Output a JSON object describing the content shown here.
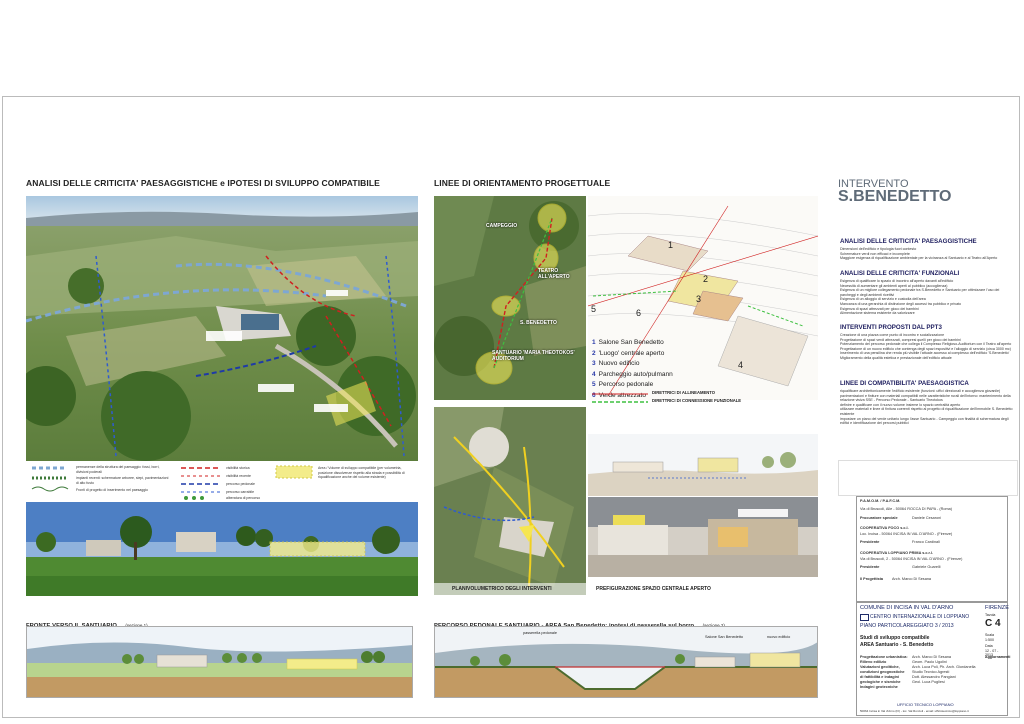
{
  "left_section": {
    "title": "ANALISI DELLE CRITICITA' PAESAGGISTICHE e IPOTESI DI SVILUPPO COMPATIBILE",
    "legend": [
      "permanenze della struttura del paesaggio: fossi, borri, divisioni poderali",
      "impianti recenti: schermature arboree, siepi, pavimentazioni di alto fusto",
      "Fronti di progetto di inserimento nel paesaggio",
      "visibilità storica",
      "visibilità recente",
      "percorso pedonale",
      "percorso carrabile",
      "alberatura di percorso",
      "Area / Volume di sviluppo compatibile (per volumetria, posizione dissolvenze rispetto alla strada e possibilità di riqualificazione anche del volume esistente)"
    ],
    "bottom_caption": "FRONTE VERSO IL SANTUARIO",
    "bottom_caption_note": "(sezione 1)"
  },
  "middle_section": {
    "title": "LINEE DI ORIENTAMENTO PROGETTUALE",
    "map_labels": {
      "campeggio": "CAMPEGGIO",
      "teatro": "TEATRO ALL'APERTO",
      "benedetto": "S. BENEDETTO",
      "santuario": "SANTUARIO 'MARIA THEOTOKOS' AUDITORIUM"
    },
    "numbered_list": [
      {
        "n": "1",
        "label": "Salone San Benedetto"
      },
      {
        "n": "2",
        "label": "'Luogo' centrale aperto"
      },
      {
        "n": "3",
        "label": "Nuovo edificio"
      },
      {
        "n": "4",
        "label": "Parcheggio auto/pulmann"
      },
      {
        "n": "5",
        "label": "Percorso pedonale"
      },
      {
        "n": "6",
        "label": "Verde attrezzato"
      }
    ],
    "direttrici": [
      "DIRETTRICI DI ALLINEAMENTO",
      "DIRETTRICI DI CONNESSIONE FUNZIONALE"
    ],
    "caption_plan": "PLANIVOLUMETRICO DEGLI INTERVENTI",
    "caption_pref": "PREFIGURAZIONE SPAZIO CENTRALE APERTO",
    "bottom_caption": "PERCORSO PEDONALE SANTUARIO - AREA San Benedetto: ipotesi di passerella sul borro",
    "bottom_caption_note": "(sezione 2)",
    "section2_labels": [
      "passerella pedonale",
      "Salone San Benedetto",
      "nuovo edificio"
    ]
  },
  "right_section": {
    "intervento": "INTERVENTO",
    "name": "S.BENEDETTO",
    "blocks": [
      {
        "title": "ANALISI DELLE CRITICITA' PAESAGGISTICHE",
        "items": [
          "Dimensioni dell'edificio e tipologia fuori contesto",
          "Schermature verdi non efficaci e incomplete",
          "Maggiore esigenza di riqualificazione ambientale per la vicinanza al Santuario e al Teatro all'Aperto"
        ]
      },
      {
        "title": "ANALISI DELLE CRITICITA' FUNZIONALI",
        "items": [
          "Esigenza di qualificare lo spazio di incontro all'aperto davanti all'edificio",
          "Necessità di aumentare gli ambienti aperti al pubblico (accoglienza)",
          "Esigenza di un migliore collegamento pedonale tra S.Benedetto e Santuario per ottimizzare l'uso dei parcheggi e degli ambienti ricettivi",
          "Esigenza di un alloggio di servizio e custodia dell'area",
          "Mancanza di una gerarchia di distinzione degli accessi tra pubblico e privato",
          "Esigenza di spazi attrezzati per gioco dei bambini",
          "Alimentazione sistema esistente da valorizzare"
        ]
      },
      {
        "title": "INTERVENTI PROPOSTI DAL PPT3",
        "items": [
          "Creazione di una piazza come punto di incontro e socializzazione",
          "Progettazione di spazi verdi attrezzati, compresi quelli per gioco dei bambini",
          "Potenziamento del percorso pedonale che collega il Complesso Religioso-Auditorium con il Teatro all'aperto",
          "Progettazione di un nuovo edificio che contenga degli spazi espositivi e l'alloggio di servizio (circa 3000 mc)",
          "Inserimento di una pensilina che renda più visibile l'attuale accesso al complesso dell'edificio 'S.Benedetto'",
          "Miglioramento della qualità estetica e prestazionale dell'edificio attuale"
        ]
      },
      {
        "title": "LINEE DI COMPATIBILITA' PAESAGGISTICA",
        "items": [
          "riqualificare architettonicamente l'edificio esistente (funzioni: uffici direzionali e accoglienza giovanile)",
          "pavimentazioni e finiture con materiali compatibili nelle caratteristiche rurali dell'intorno: mantenimento della relazione visiva SSE - Percorso Pedonale - Santuario Theotokos",
          "definire e qualificare con il nuovo volume insieme lo spazio centralità aperto",
          "utilizzare materiali e linee di finitura coerenti rispetto al progetto di riqualificazione dell'immobile S. Benedetto esistente",
          "impostare un piano del verde unitario lungo l'asse Santuario - Campeggio con finalità di schermatura degli edifici e identificazione dei percorsi pubblici"
        ]
      }
    ],
    "title_block": {
      "org": "P.A.M.O.M. / P.A.F.C.M.",
      "addr": "Via di Bruscoli, Alle - 50064 ROCCA DI PAPA - (Roma)",
      "proc_label": "Procuratore speciale",
      "proc_value": "Daniele Cesaroni",
      "coop1": "COOPERATIVA FOCO s.c.l.",
      "coop1_addr": "Loc. Incisa - 50064 INCISA IN VAL D'ARNO - (Firenze)",
      "pres_label": "Presidente",
      "pres1": "Franco Cardinali",
      "coop2": "COOPERATIVA LOPPIANO PRIMA s.c.r.l.",
      "coop2_addr": "Via di Bruscoli, 2 - 50064 INCISA IN VAL D'ARNO - (Firenze)",
      "pres2": "Gabriele Guarelli",
      "prog_label": "Il Progettista",
      "prog_value": "Arch. Marco Di Sesana",
      "comune": "COMUNE DI INCISA IN VAL D'ARNO",
      "firenze": "FIRENZE",
      "centro": "CENTRO INTERNAZIONALE DI LOPPIANO",
      "piano": "PIANO PARTICOLAREGGIATO 3 / 2013",
      "tavola_label": "Tavola",
      "tavola": "C 4",
      "studi": "Studi di sviluppo compatibile",
      "area": "AREA Santuario - S. Benedetto",
      "scala_label": "Scala",
      "scala": "1:500",
      "data_label": "Data",
      "data": "12 - 07 - 2013",
      "agg_label": "Aggiornamenti",
      "credits_labels": [
        "Progettazione urbanistica:",
        "Rilievo edilizio",
        "Valutazioni geolitiche, condizioni geognostiche di fattibilità e indagini geologiche e sismiche",
        "Indagini geotecniche"
      ],
      "credits_values": [
        "Arch. Marco Di Sesana",
        "Geom. Paolo Ugolini",
        "Arch. Luca Poli, Ph. Arch. Giordanella",
        "Studio Tecnico Agresti",
        "Dott. Alessandro Pangiani",
        "Geol. Luca Pugliesi"
      ],
      "ufficio": "UFFICIO TECNICO LOPPIANO",
      "ufficio_addr": "50064 Incisa in Val d'Arno (FI) - loc. Val Ronzoli - email: ufficiotecnico@loppiano.it"
    }
  }
}
